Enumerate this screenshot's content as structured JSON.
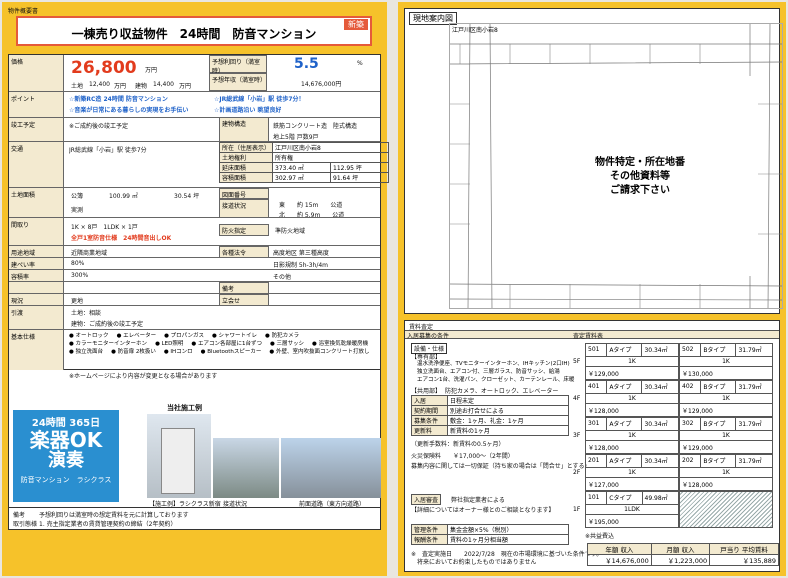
{
  "left": {
    "doc_code": "物件概要書",
    "title": "一棟売り収益物件　24時間　防音マンション",
    "badge": "新築",
    "price_label": "価格",
    "price": "26,800",
    "price_unit": "万円",
    "land_label": "土地",
    "land_value": "12,400",
    "land_unit": "万円",
    "bldg_label": "建物",
    "bldg_value": "14,400",
    "bldg_unit": "万円",
    "yield_label": "予想利回り（満室時）",
    "yield_value": "5.5",
    "yield_unit": "%",
    "annual_label": "予想年収（満室時）",
    "annual_value": "14,676,000円",
    "points_label": "ポイント",
    "point1": "☆新築RC造 24時間 防音マンション",
    "point2": "☆JR総武線「小岩」駅 徒歩7分！",
    "point3": "☆音楽が日常にある暮らしの実現をお手伝い",
    "point4": "☆計画道路沿い 眺望良好",
    "completion_label": "竣工予定",
    "completion_value": "※ご成約後の竣工予定",
    "structure_label": "建物構造",
    "structure_value": "鉄筋コンクリート造　陸式構造",
    "floors_value": "地上5階 戸数9戸",
    "traffic_label": "交通",
    "traffic_value": "JR総武線「小岩」駅 徒歩7分",
    "address_label": "所在（住居表示）",
    "address_value": "江戸川区南小岩8",
    "rights_label": "土地権利",
    "rights_value": "所有権",
    "floor_area_label": "延床面積",
    "floor_area_m2": "373.40 ㎡",
    "floor_area_tsubo": "112.95 坪",
    "volume_label": "容積面積",
    "volume_m2": "302.97 ㎡",
    "volume_tsubo": "91.64 坪",
    "land_area_label": "土地面積",
    "land_area_public": "公簿",
    "land_area_m2": "100.99 ㎡",
    "land_area_tsubo": "30.54 坪",
    "land_area_actual": "実測",
    "road_no_label": "図面番号",
    "road_label": "接道状況",
    "road1": "東　　約 15m　　公道",
    "road2": "北　　約 5.9m　　公道",
    "layout_label": "間取り",
    "layout_value": "1K × 8戸　1LDK × 1戸",
    "layout_note": "全戸1室防音仕様　24時間音出しOK",
    "fire_label": "防火指定",
    "fire_value": "準防火地域",
    "zoning_label": "用途地域",
    "zoning_value": "近隣商業地域",
    "coverage_label": "建ぺい率",
    "coverage_value": "80%",
    "far_label": "容積率",
    "far_value": "300%",
    "laws_label": "各種法令",
    "law1": "高度地区  第三種高度",
    "law2": "日影規制  5h-3h/4m",
    "law3": "その他",
    "remarks_label": "備考",
    "status_label": "現況",
    "status_value": "更地",
    "delivery_label": "引渡",
    "delivery_land": "土地：相談",
    "delivery_bldg": "建物：ご成約後の竣工予定",
    "meet_label": "立会せ",
    "features_label": "基本仕様",
    "features": [
      "● オートロック",
      "● エレベーター",
      "● プロパンガス",
      "● シャワートイレ",
      "● 防犯カメラ",
      "● カラーモニターインターホン",
      "● LED照明",
      "● エアコン各部屋に1台ずつ",
      "● 三層サッシ",
      "● 浴室換気乾燥暖房機",
      "● 独立洗面台",
      "● 防音扉 2枚扱い",
      "● IHコンロ",
      "● Bluetoothスピーカー",
      "● 外壁、室内吹抜面コンクリート打放し"
    ],
    "features_note": "※ホームページにより内容が変更となる場合があります",
    "logo_line1": "24時間 365日",
    "logo_line2": "楽器OK",
    "logo_sub": "演奏",
    "logo_tag": "防音マンション　ラシクラス",
    "photos_title": "当社施工例",
    "caption1": "【施工例】ラシクラス新宿",
    "caption2": "接道状況",
    "caption3": "前面道路（東方向道路）",
    "note_label": "備考",
    "note_value": "予想利回りは満室時の想定賃料を元に計算しております",
    "contract_label": "取引態様",
    "contract_value": "1. 売主指定業者の賃貸管理契約の締結（2年契約）"
  },
  "right": {
    "map_title": "現地案内図",
    "map_address": "江戸川区南小岩8",
    "map_notice_1": "物件特定・所在地番",
    "map_notice_2": "その他資料等",
    "map_notice_3": "ご請求下さい",
    "rent_title": "賃料査定",
    "cond_label": "入居募集の条件",
    "rent_sched_label": "査定賃料表",
    "equip_title": "設備・仕様",
    "private_title": "【専有部】",
    "private_lines": [
      "温水洗浄便座、TVモニターインターホン、IHキッチン(2口IH)",
      "独立洗面台、エアコン付、三層ガラス、防音サッシ、給湯",
      "エアコン1台、洗濯パン、クローゼット、カーテンレール、床暖"
    ],
    "common_title": "【共用部】",
    "common_value": "防犯カメラ、オートロック、エレベーター",
    "movein_label": "入居",
    "movein_value": "日程未定",
    "contract_period_label": "契約期間",
    "contract_period_value": "別途お打合せによる",
    "terms_label": "募集条件",
    "terms_value": "敷金：1ヶ月、礼金：1ヶ月",
    "renew_label": "更新料",
    "renew_value": "新賃料の1ヶ月",
    "renew_note": "（更新手数料：新賃料の0.5ヶ月）",
    "insurance_label": "火災保険料",
    "insurance_value": "￥17,000～（2年間）",
    "insurance_note": "募集内容に関しては一切保証（持ち家の場合は「問合せ」とする）",
    "move_terms_label": "入居審査",
    "move_terms_value": "弊社指定業者による",
    "move_terms_note": "【詳細についてはオーナー様とのご相談となります】",
    "mgmt_label": "管理条件",
    "mgmt_value": "集金金額×5%（税別）",
    "fee_label": "報酬条件",
    "fee_value": "賃料の1ヶ月分相当額",
    "footer_note": "※　査定実施日　　2022/7/28　現在の市場環境に基づいた条件です。",
    "footer_note2": "　将来においてお約束したものではありません",
    "common_fee_label": "※共益費込",
    "floors": [
      {
        "floor": "5F",
        "a": [
          "501",
          "Aタイプ",
          "30.34㎡",
          "1K",
          "￥129,000"
        ],
        "b": [
          "502",
          "Bタイプ",
          "31.79㎡",
          "1K",
          "￥130,000"
        ]
      },
      {
        "floor": "4F",
        "a": [
          "401",
          "Aタイプ",
          "30.34㎡",
          "1K",
          "￥128,000"
        ],
        "b": [
          "402",
          "Bタイプ",
          "31.79㎡",
          "1K",
          "￥129,000"
        ]
      },
      {
        "floor": "3F",
        "a": [
          "301",
          "Aタイプ",
          "30.34㎡",
          "1K",
          "￥128,000"
        ],
        "b": [
          "302",
          "Bタイプ",
          "31.79㎡",
          "1K",
          "￥129,000"
        ]
      },
      {
        "floor": "2F",
        "a": [
          "201",
          "Aタイプ",
          "30.34㎡",
          "1K",
          "￥127,000"
        ],
        "b": [
          "202",
          "Bタイプ",
          "31.79㎡",
          "1K",
          "￥128,000"
        ]
      },
      {
        "floor": "1F",
        "a": [
          "101",
          "Cタイプ",
          "49.98㎡",
          "1LDK",
          "￥195,000"
        ]
      }
    ],
    "annual_head": "年額 収入",
    "monthly_head": "月額 収入",
    "avg_head": "戸当り 平均賃料",
    "annual_total": "￥14,676,000",
    "monthly_total": "￥1,223,000",
    "avg_total": "￥135,889"
  }
}
